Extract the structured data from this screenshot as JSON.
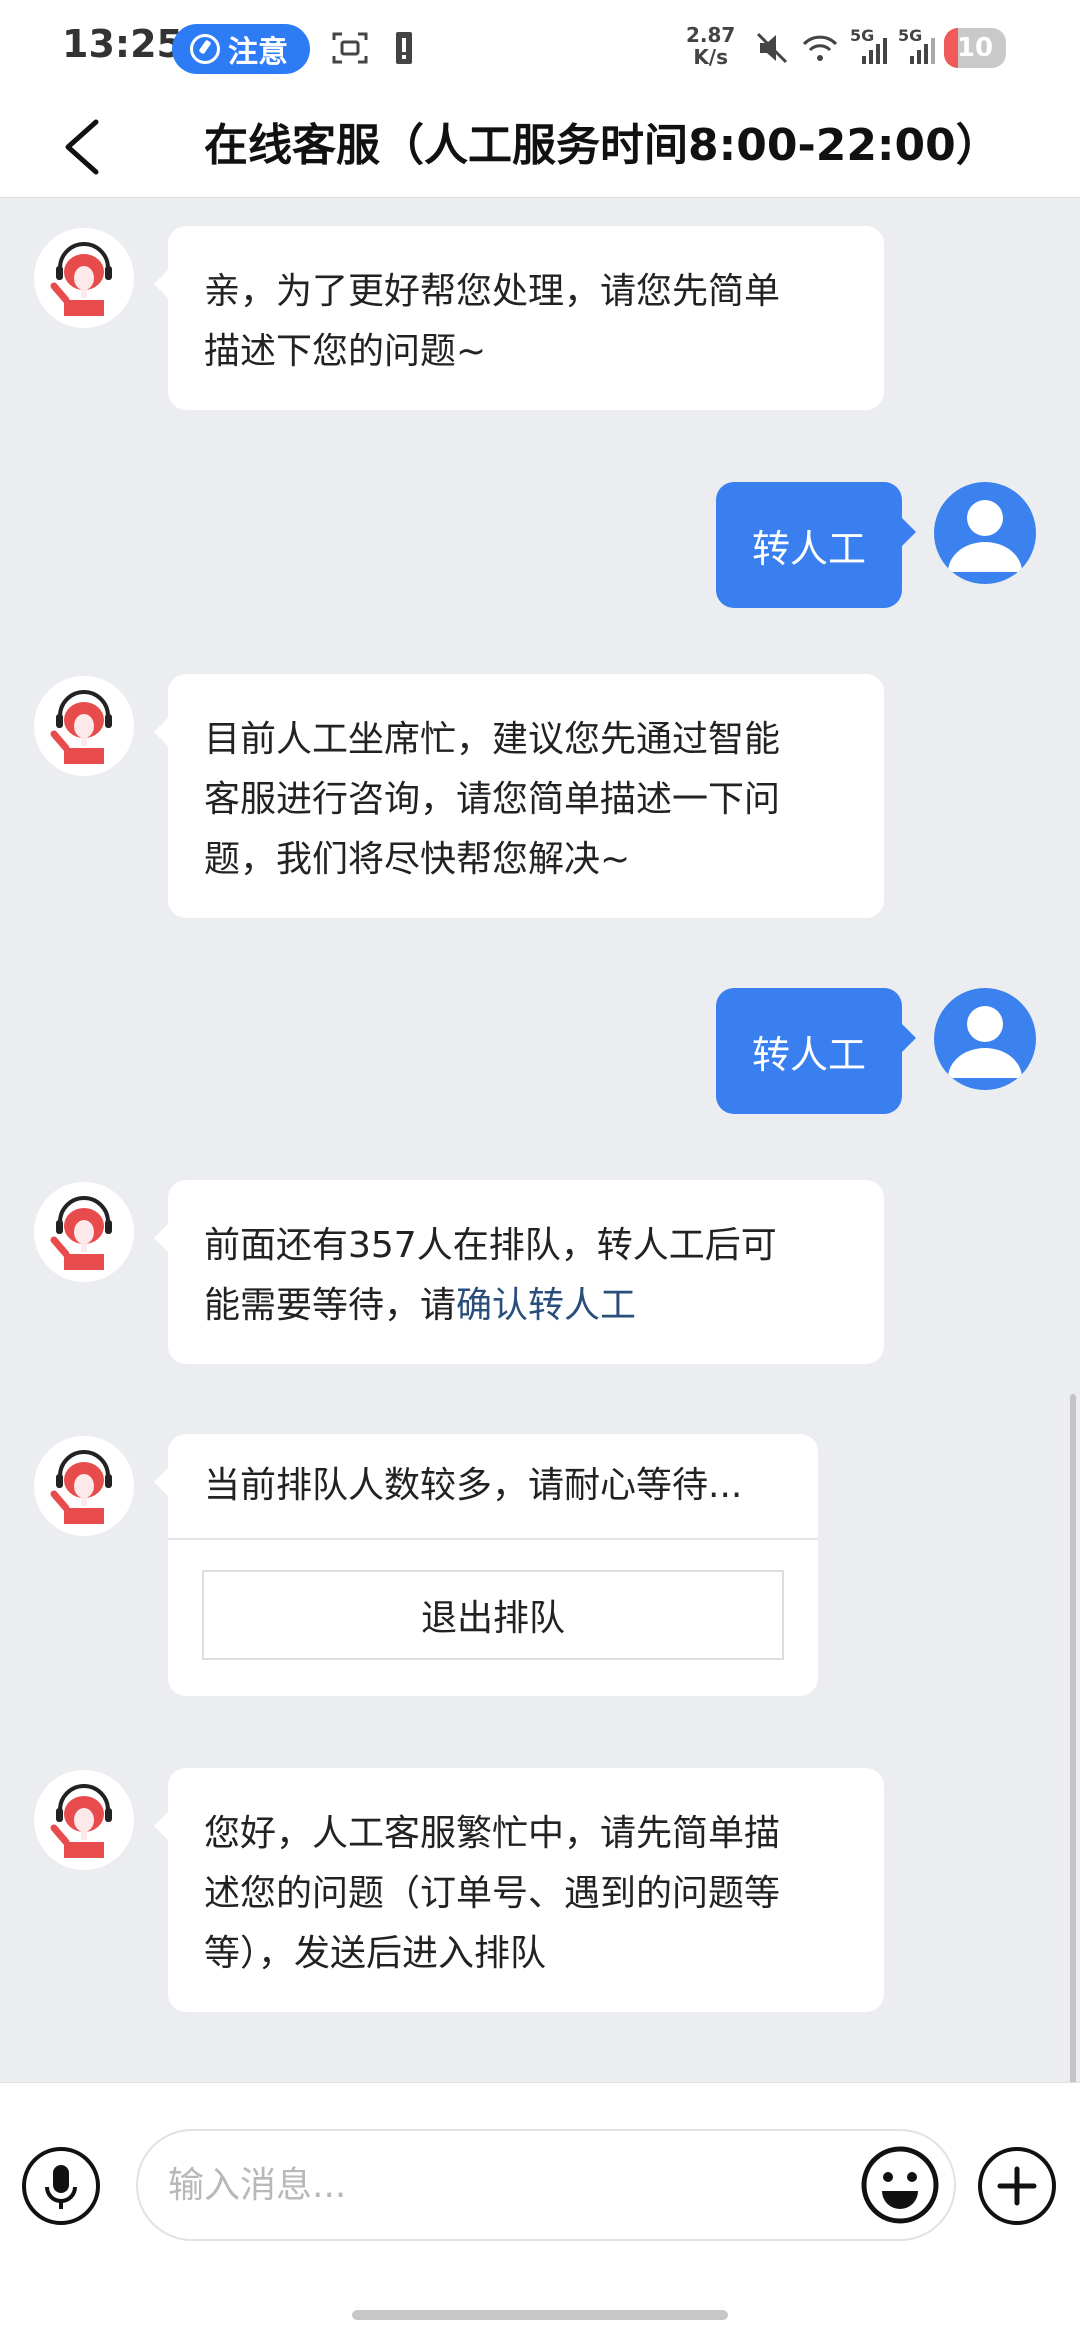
{
  "status_bar": {
    "time": "13:25",
    "notice_label": "注意",
    "net_speed_value": "2.87",
    "net_speed_unit": "K/s",
    "signal_1": "5G",
    "signal_2": "5G",
    "battery": "10"
  },
  "header": {
    "title": "在线客服（人工服务时间8:00-22:00）"
  },
  "messages": [
    {
      "side": "left",
      "text_lines": [
        "亲，为了更好帮您处理，请您先简单",
        "描述下您的问题~"
      ]
    },
    {
      "side": "right",
      "text": "转人工"
    },
    {
      "side": "left",
      "text_lines": [
        "目前人工坐席忙，建议您先通过智能",
        "客服进行咨询，请您简单描述一下问",
        "题，我们将尽快帮您解决~"
      ]
    },
    {
      "side": "right",
      "text": "转人工"
    },
    {
      "side": "left",
      "line1": "前面还有357人在排队，转人工后可",
      "line2_prefix": "能需要等待，请",
      "line2_link": "确认转人工"
    },
    {
      "side": "left",
      "card_text": "当前排队人数较多，请耐心等待...",
      "card_button": "退出排队"
    },
    {
      "side": "left",
      "text_lines": [
        "您好，人工客服繁忙中，请先简单描",
        "述您的问题（订单号、遇到的问题等",
        "等），发送后进入排队"
      ]
    }
  ],
  "input": {
    "placeholder": "输入消息..."
  },
  "colors": {
    "accent": "#3a7ff0",
    "background": "#ebedf0",
    "link": "#2a4e7a"
  }
}
